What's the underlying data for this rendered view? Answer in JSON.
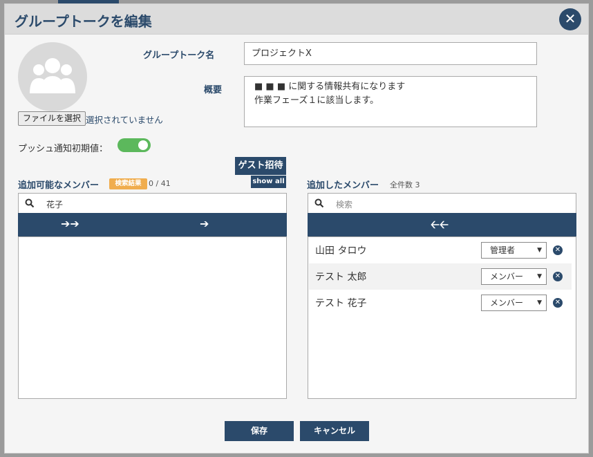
{
  "dialog": {
    "title": "グループトークを編集",
    "close_icon": "close-icon"
  },
  "profile": {
    "avatar_icon": "group-icon",
    "file_button_label": "ファイルを選択",
    "file_status": "選択されていません"
  },
  "form": {
    "name_label": "グループトーク名",
    "name_value": "プロジェクトX",
    "summary_label": "概要",
    "summary_line1": "■ ■ ■ に関する情報共有になります",
    "summary_line2": "作業フェーズ１に該当します。",
    "push_label": "プッシュ通知初期値：",
    "push_enabled": true
  },
  "available": {
    "title": "追加可能なメンバー",
    "badge": "検索結果",
    "count": "0 / 41",
    "guest_button": "ゲスト招待",
    "show_all_button": "show all",
    "search_value": "花子",
    "arrow_label": "➔➔",
    "arrow_single": "➔",
    "items": []
  },
  "added": {
    "title": "追加したメンバー",
    "count": "全件数 3",
    "search_placeholder": "検索",
    "arrow_label": "🡠🡠",
    "members": [
      {
        "name": "山田 タロウ",
        "role": "管理者"
      },
      {
        "name": "テスト 太郎",
        "role": "メンバー"
      },
      {
        "name": "テスト 花子",
        "role": "メンバー"
      }
    ]
  },
  "footer": {
    "save_label": "保存",
    "cancel_label": "キャンセル"
  },
  "colors": {
    "primary": "#2b4a6b",
    "toggle_on": "#5cb85c",
    "badge": "#f0ad4e"
  }
}
